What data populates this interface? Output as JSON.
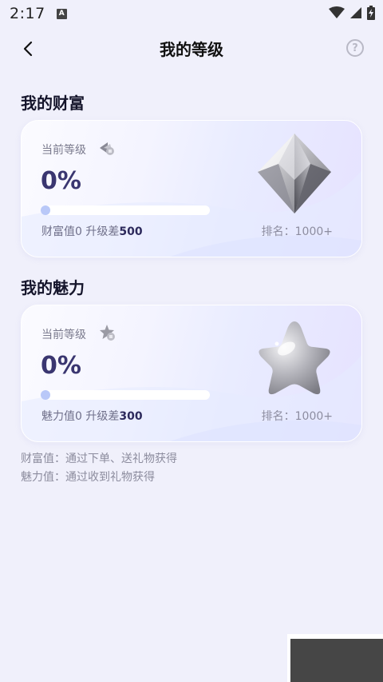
{
  "status_bar": {
    "time": "2:17",
    "app_icon_letter": "A"
  },
  "header": {
    "title": "我的等级",
    "help_label": "?"
  },
  "wealth": {
    "section_title": "我的财富",
    "current_level_label": "当前等级",
    "percent_text": "0%",
    "progress_fraction": 0,
    "diff_prefix": "财富值0 升级差",
    "diff_value": "500",
    "rank_text": "排名：1000+",
    "icon": "crystal-gem"
  },
  "charm": {
    "section_title": "我的魅力",
    "current_level_label": "当前等级",
    "percent_text": "0%",
    "progress_fraction": 0,
    "diff_prefix": "魅力值0 升级差",
    "diff_value": "300",
    "rank_text": "排名：1000+",
    "icon": "silver-star"
  },
  "notes": {
    "wealth_note": "财富值：通过下单、送礼物获得",
    "charm_note": "魅力值：通过收到礼物获得"
  },
  "colors": {
    "background": "#f0f0fb",
    "percent_text": "#3a3670",
    "progress_dot": "#b9c8f8"
  }
}
